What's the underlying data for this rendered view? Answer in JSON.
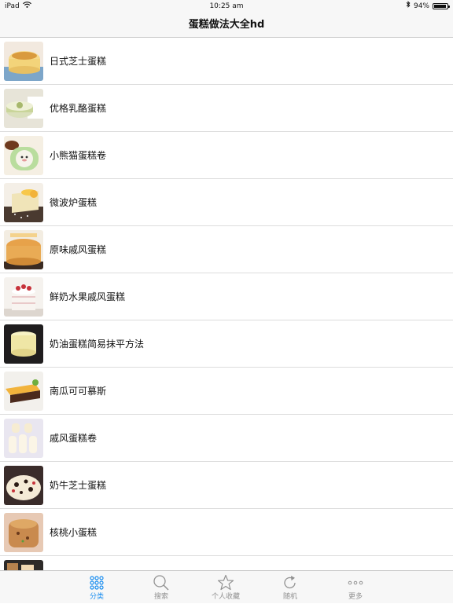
{
  "status_bar": {
    "device": "iPad",
    "time": "10:25 am",
    "battery_percent": 94,
    "battery_text": "94%"
  },
  "nav": {
    "title": "蛋糕做法大全hd"
  },
  "list": {
    "items": [
      {
        "label": "日式芝士蛋糕"
      },
      {
        "label": "优格乳酪蛋糕"
      },
      {
        "label": "小熊猫蛋糕卷"
      },
      {
        "label": "微波炉蛋糕"
      },
      {
        "label": "原味戚风蛋糕"
      },
      {
        "label": "鲜奶水果戚风蛋糕"
      },
      {
        "label": "奶油蛋糕简易抹平方法"
      },
      {
        "label": "南瓜可可慕斯"
      },
      {
        "label": "戚风蛋糕卷"
      },
      {
        "label": "奶牛芝士蛋糕"
      },
      {
        "label": "核桃小蛋糕"
      },
      {
        "label": ""
      }
    ]
  },
  "tab_bar": {
    "tabs": [
      {
        "label": "分类",
        "icon": "grid-icon",
        "active": true
      },
      {
        "label": "搜索",
        "icon": "search-icon",
        "active": false
      },
      {
        "label": "个人收藏",
        "icon": "star-icon",
        "active": false
      },
      {
        "label": "随机",
        "icon": "refresh-icon",
        "active": false
      },
      {
        "label": "更多",
        "icon": "more-icon",
        "active": false
      }
    ]
  },
  "colors": {
    "accent": "#1a8ef0",
    "inactive": "#929292",
    "bar_background": "#f7f7f7",
    "separator": "#dcdcdc"
  }
}
